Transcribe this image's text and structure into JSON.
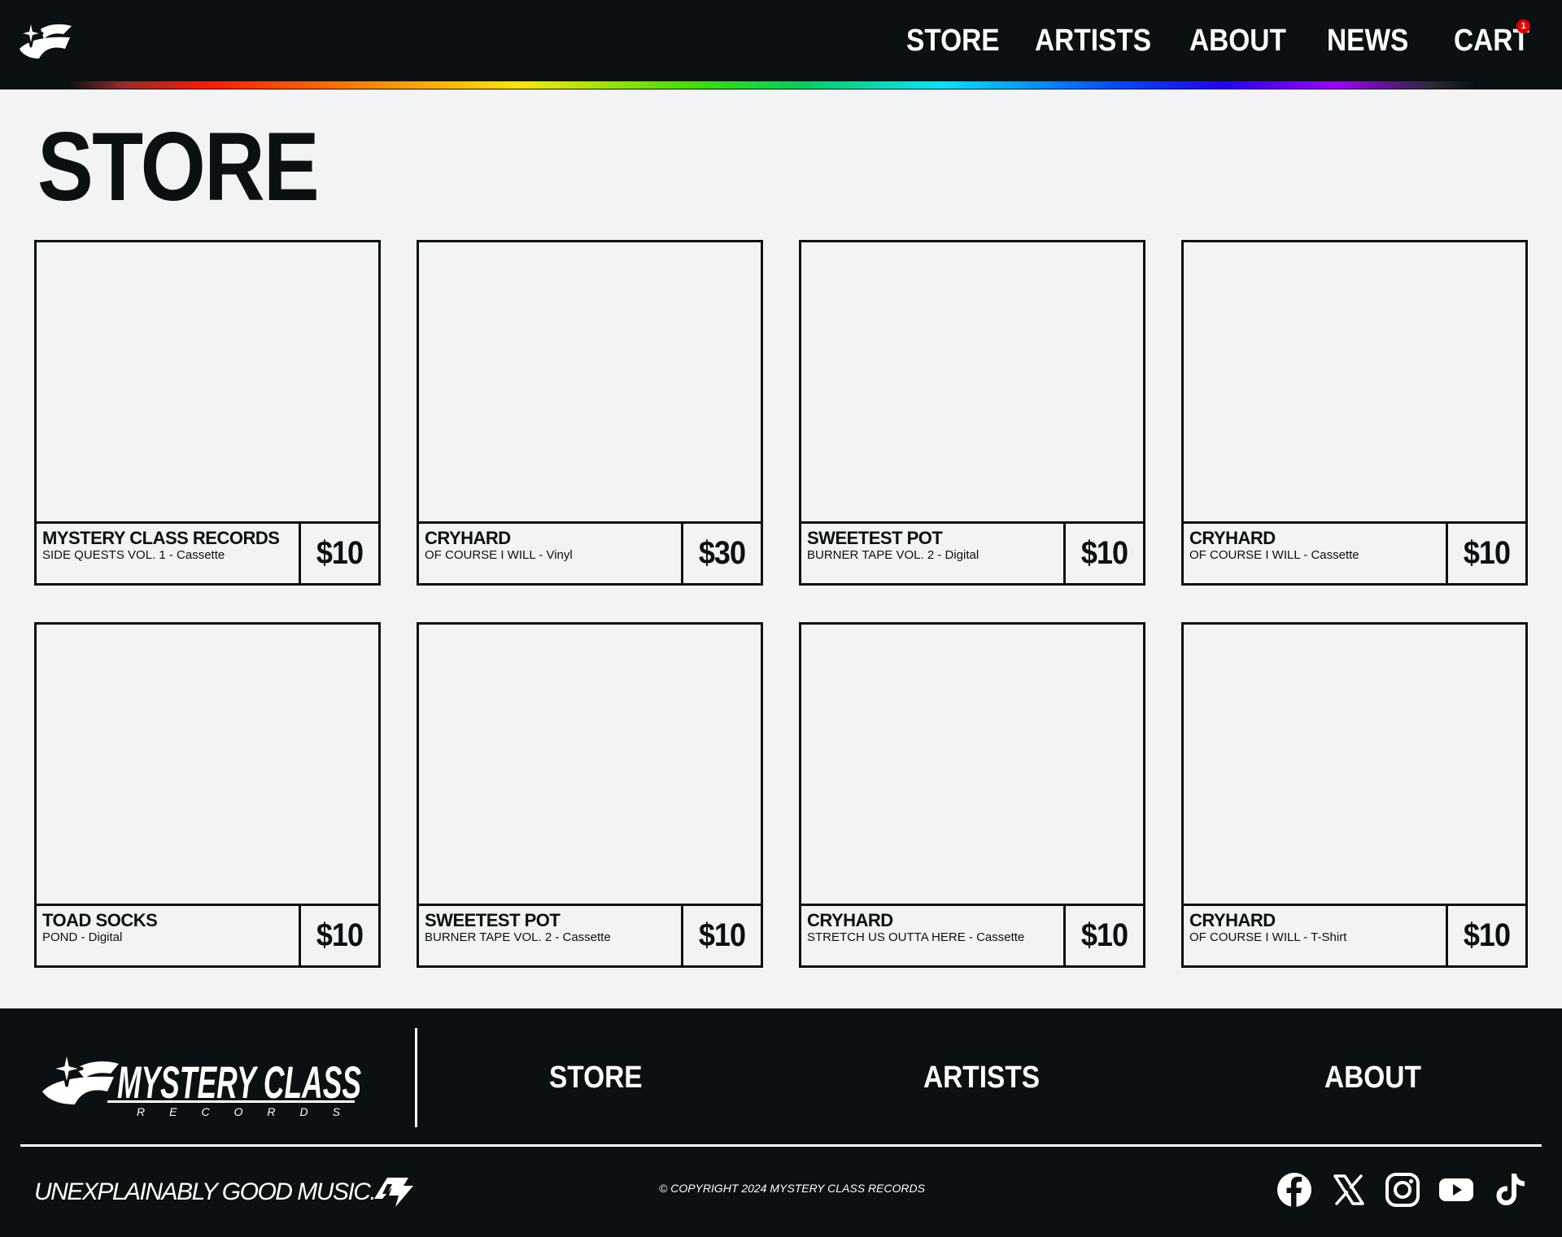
{
  "header": {
    "logo_icon": "star-swoosh-logo-icon",
    "nav": [
      {
        "label": "STORE"
      },
      {
        "label": "ARTISTS"
      },
      {
        "label": "ABOUT"
      },
      {
        "label": "NEWS"
      },
      {
        "label": "CART"
      }
    ],
    "cart_count": "1",
    "colors": {
      "background": "#0b1013",
      "badge": "#e10000"
    }
  },
  "page": {
    "title": "STORE",
    "background": "#f2f3f4"
  },
  "products": [
    {
      "artist": "MYSTERY CLASS RECORDS",
      "subtitle": "SIDE QUESTS VOL. 1 - Cassette",
      "price": "$10"
    },
    {
      "artist": "CRYHARD",
      "subtitle": "OF COURSE I WILL - Vinyl",
      "price": "$30"
    },
    {
      "artist": "SWEETEST POT",
      "subtitle": "BURNER TAPE VOL. 2 - Digital",
      "price": "$10"
    },
    {
      "artist": "CRYHARD",
      "subtitle": "OF COURSE I WILL - Cassette",
      "price": "$10"
    },
    {
      "artist": "TOAD SOCKS",
      "subtitle": "POND - Digital",
      "price": "$10"
    },
    {
      "artist": "SWEETEST POT",
      "subtitle": "BURNER TAPE VOL. 2 - Cassette",
      "price": "$10"
    },
    {
      "artist": "CRYHARD",
      "subtitle": "STRETCH US OUTTA HERE - Cassette",
      "price": "$10"
    },
    {
      "artist": "CRYHARD",
      "subtitle": "OF COURSE I WILL - T-Shirt",
      "price": "$10"
    }
  ],
  "footer": {
    "logo_text": "MYSTERY CLASS",
    "logo_subtext": "R E C O R D S",
    "links": [
      {
        "label": "STORE"
      },
      {
        "label": "ARTISTS"
      },
      {
        "label": "ABOUT"
      }
    ],
    "tagline": "UNEXPLAINABLY GOOD MUSIC.",
    "copyright": "© COPYRIGHT 2024 MYSTERY CLASS RECORDS",
    "social": [
      "facebook-icon",
      "x-icon",
      "instagram-icon",
      "youtube-icon",
      "tiktok-icon"
    ]
  }
}
